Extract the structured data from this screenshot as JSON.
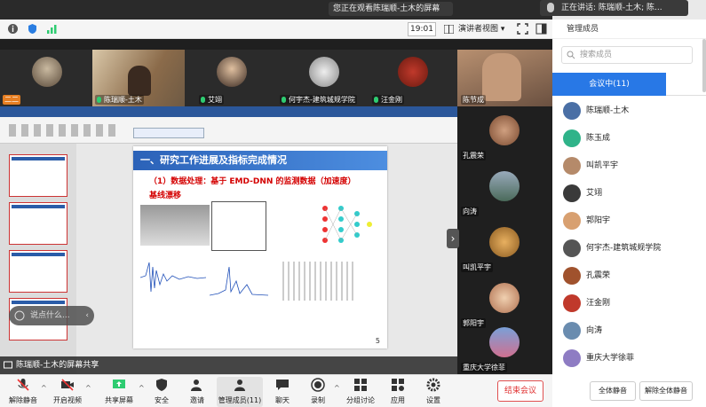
{
  "top": {
    "share_banner": "您正在观看陈瑞顺-土木的屏幕",
    "speaker_banner": "正在讲话: 陈瑞顺-土木; 陈...",
    "time": "19:01",
    "view_label": "演讲者视图"
  },
  "participants_strip": [
    {
      "name": "二二"
    },
    {
      "name": "陈瑞顺-土木"
    },
    {
      "name": "艾翊"
    },
    {
      "name": "何宇杰-建筑城规学院"
    },
    {
      "name": "汪金刚"
    },
    {
      "name": "陈节成"
    }
  ],
  "side_tiles": [
    {
      "name": "孔震荣"
    },
    {
      "name": "向涛"
    },
    {
      "name": "叫凯平宇"
    },
    {
      "name": "郭阳宇"
    },
    {
      "name": "重庆大学徐菲"
    }
  ],
  "slide": {
    "heading": "一、研究工作进展及指标完成情况",
    "subtitle_line1": "（1）数据处理：基于 EMD-DNN 的监测数据（加速度）",
    "subtitle_line2": "基线漂移",
    "page_number": "5"
  },
  "overlay": {
    "danmu_placeholder": "说点什么...",
    "share_status": "陈瑞顺-土木的屏幕共享"
  },
  "panel": {
    "title": "管理成员",
    "search_placeholder": "搜索成员",
    "tab_label": "会议中(11)",
    "members": [
      {
        "name": "陈瑞顺-土木",
        "color": "#4a6fa5"
      },
      {
        "name": "陈玉成",
        "color": "#2fb389"
      },
      {
        "name": "叫凯平宇",
        "color": "#b58a6a"
      },
      {
        "name": "艾翊",
        "color": "#3a3a3a"
      },
      {
        "name": "郭阳宇",
        "color": "#d8a070"
      },
      {
        "name": "何宇杰-建筑城规学院",
        "color": "#555555"
      },
      {
        "name": "孔震荣",
        "color": "#a0522d"
      },
      {
        "name": "汪金刚",
        "color": "#c0392b"
      },
      {
        "name": "向涛",
        "color": "#6a8caf"
      },
      {
        "name": "重庆大学徐菲",
        "color": "#8e7cc3"
      }
    ],
    "mute_all": "全体静音",
    "unmute_all": "解除全体静音"
  },
  "bottom_toolbar": {
    "unmute": "解除静音",
    "start_video": "开启视频",
    "share_screen": "共享屏幕",
    "security": "安全",
    "invite": "邀请",
    "manage_members": "管理成员(11)",
    "chat": "聊天",
    "record": "录制",
    "breakout": "分组讨论",
    "apps": "应用",
    "settings": "设置",
    "end_meeting": "结束会议"
  }
}
